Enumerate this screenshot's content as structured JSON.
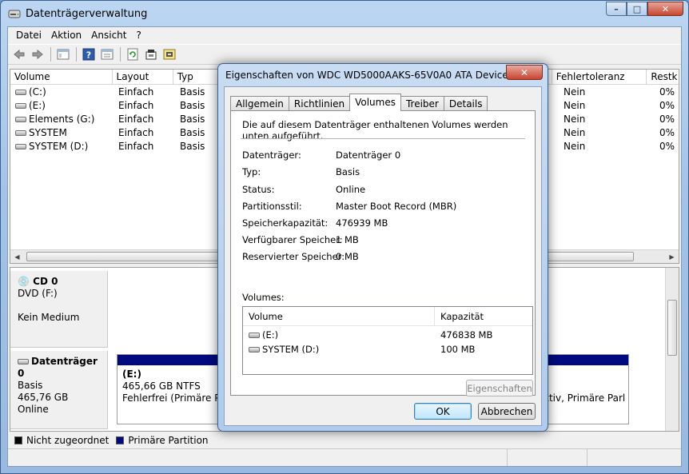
{
  "window": {
    "title": "Datenträgerverwaltung",
    "controls": {
      "minimize": "–",
      "maximize": "□",
      "close": "✕"
    }
  },
  "menu": [
    "Datei",
    "Aktion",
    "Ansicht",
    "?"
  ],
  "toolbar_icons": [
    "back-arrow-icon",
    "forward-arrow-icon",
    "console-tree-icon",
    "help-icon",
    "properties-icon",
    "refresh-icon",
    "rescan-icon",
    "settings-icon"
  ],
  "volume_list": {
    "columns": [
      "Volume",
      "Layout",
      "Typ",
      "Fehlertoleranz",
      "Restk"
    ],
    "rows": [
      {
        "volume": "(C:)",
        "layout": "Einfach",
        "typ": "Basis",
        "fehler": "Nein",
        "rest": "0%"
      },
      {
        "volume": "(E:)",
        "layout": "Einfach",
        "typ": "Basis",
        "fehler": "Nein",
        "rest": "0%"
      },
      {
        "volume": "Elements (G:)",
        "layout": "Einfach",
        "typ": "Basis",
        "fehler": "Nein",
        "rest": "0%"
      },
      {
        "volume": "SYSTEM",
        "layout": "Einfach",
        "typ": "Basis",
        "fehler": "Nein",
        "rest": "0%"
      },
      {
        "volume": "SYSTEM (D:)",
        "layout": "Einfach",
        "typ": "Basis",
        "fehler": "Nein",
        "rest": "0%"
      }
    ]
  },
  "disks": {
    "cd": {
      "name": "CD 0",
      "line1": "DVD (F:)",
      "line2": "Kein Medium"
    },
    "disk0": {
      "name": "Datenträger 0",
      "type": "Basis",
      "size": "465,76 GB",
      "status": "Online",
      "partition1": {
        "label": "(E:)",
        "size": "465,66 GB NTFS",
        "status": "Fehlerfrei (Primäre Partition"
      },
      "partition2": {
        "label": ")",
        "status": "ktiv, Primäre Parl"
      }
    }
  },
  "legend": {
    "unallocated": "Nicht zugeordnet",
    "primary": "Primäre Partition",
    "unallocated_color": "#000000",
    "primary_color": "#000a7f"
  },
  "dialog": {
    "title": "Eigenschaften von WDC WD5000AAKS-65V0A0 ATA Device",
    "close": "✕",
    "tabs": [
      "Allgemein",
      "Richtlinien",
      "Volumes",
      "Treiber",
      "Details"
    ],
    "active_tab": "Volumes",
    "description": "Die auf diesem Datenträger enthaltenen Volumes werden unten aufgeführt.",
    "properties": [
      {
        "label": "Datenträger:",
        "value": "Datenträger 0"
      },
      {
        "label": "Typ:",
        "value": "Basis"
      },
      {
        "label": "Status:",
        "value": "Online"
      },
      {
        "label": "Partitionsstil:",
        "value": "Master Boot Record (MBR)"
      },
      {
        "label": "Speicherkapazität:",
        "value": "476939 MB"
      },
      {
        "label": "Verfügbarer Speicher:",
        "value": "1 MB"
      },
      {
        "label": "Reservierter Speicher:",
        "value": "0 MB"
      }
    ],
    "volumes_label": "Volumes:",
    "volumes_columns": [
      "Volume",
      "Kapazität"
    ],
    "volumes": [
      {
        "name": "(E:)",
        "capacity": "476838 MB"
      },
      {
        "name": "SYSTEM (D:)",
        "capacity": "100 MB"
      }
    ],
    "properties_button": "Eigenschaften",
    "ok": "OK",
    "cancel": "Abbrechen"
  }
}
